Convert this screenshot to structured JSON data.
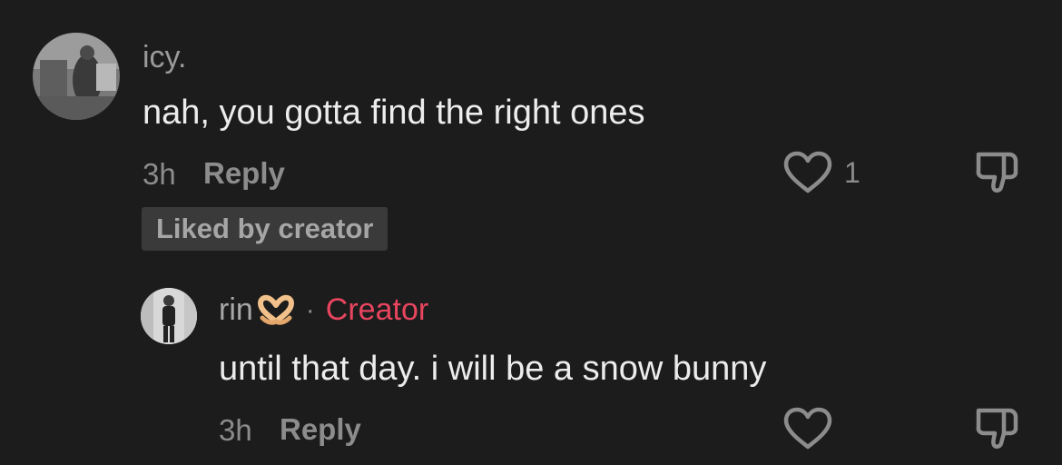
{
  "comment": {
    "username": "icy.",
    "text": "nah, you gotta find the right ones",
    "time": "3h",
    "reply_label": "Reply",
    "like_count": "1",
    "liked_badge": "Liked by creator",
    "avatar_icon": "user-photo"
  },
  "reply": {
    "username": "rin",
    "username_emoji": "🫶",
    "separator": "·",
    "creator_label": "Creator",
    "text": "until that day. i will be a snow bunny",
    "time": "3h",
    "reply_label": "Reply",
    "avatar_icon": "user-photo"
  },
  "colors": {
    "background": "#1c1c1c",
    "creator_accent": "#e8455f",
    "muted_text": "#8c8c8c",
    "primary_text": "#ececec",
    "badge_bg": "#3a3a3a"
  },
  "icons": {
    "like": "heart-outline-icon",
    "dislike": "thumbs-down-outline-icon",
    "heart_hands": "heart-hands-emoji"
  }
}
